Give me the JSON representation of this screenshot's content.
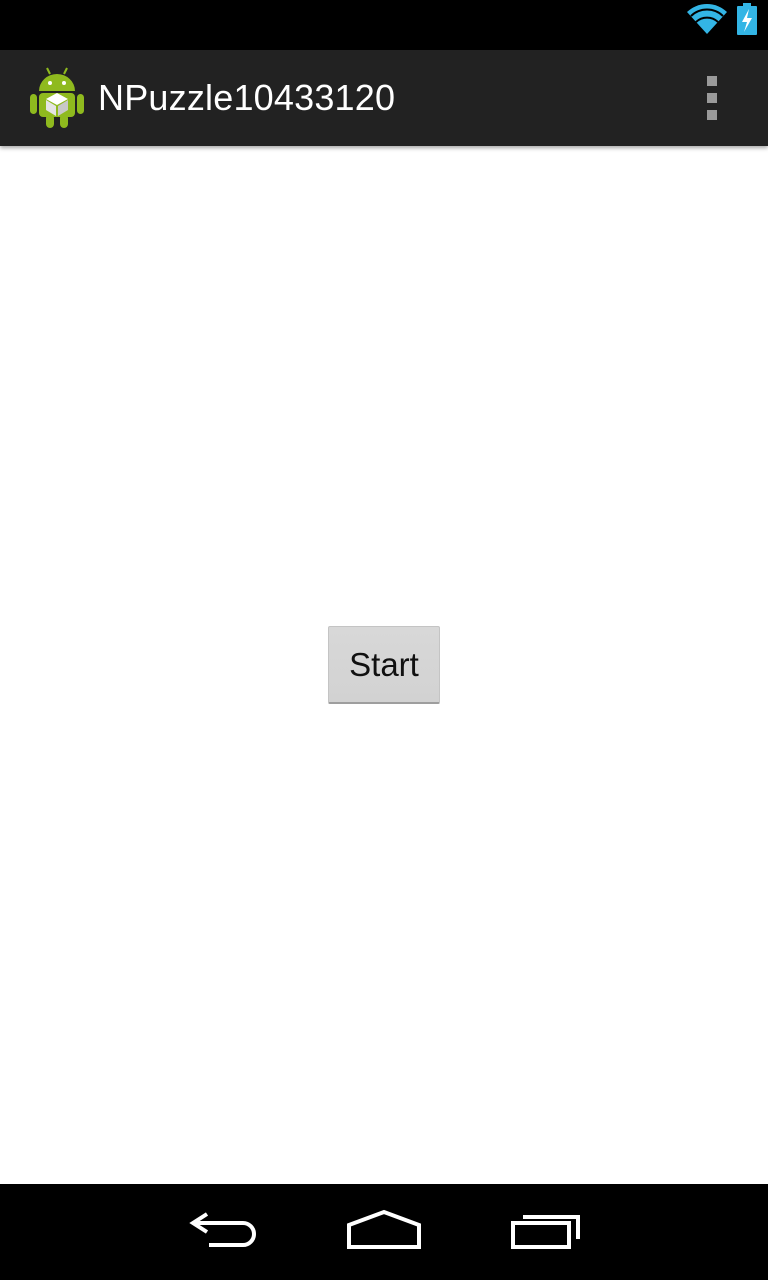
{
  "status_bar": {
    "icons": [
      "wifi-icon",
      "battery-charging-icon"
    ],
    "accent_color": "#33b5e5"
  },
  "action_bar": {
    "title": "NPuzzle10433120",
    "logo_icon": "android-app-icon",
    "overflow_icon": "overflow-menu-icon",
    "background_color": "#222222"
  },
  "main": {
    "start_button_label": "Start"
  },
  "nav_bar": {
    "icons": [
      "back-icon",
      "home-icon",
      "recent-apps-icon"
    ]
  }
}
